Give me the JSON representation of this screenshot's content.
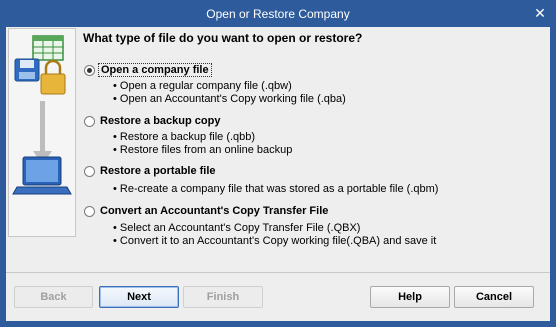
{
  "window": {
    "title": "Open or Restore Company",
    "close_glyph": "✕"
  },
  "question": "What type of file do you want to open or restore?",
  "options": [
    {
      "label": "Open a company file",
      "checked": true,
      "bullets": [
        "Open a regular company file (.qbw)",
        "Open an Accountant's Copy working file (.qba)"
      ]
    },
    {
      "label": "Restore a backup copy",
      "checked": false,
      "bullets": [
        "Restore a backup file (.qbb)",
        "Restore files from an online backup"
      ]
    },
    {
      "label": "Restore a portable file",
      "checked": false,
      "bullets": [
        "Re-create a company file that was stored as a portable file (.qbm)"
      ]
    },
    {
      "label": "Convert an Accountant's Copy Transfer File",
      "checked": false,
      "bullets": [
        "Select an Accountant's Copy Transfer File (.QBX)",
        "Convert it to an Accountant's Copy working file(.QBA) and save it"
      ]
    }
  ],
  "buttons": {
    "back": "Back",
    "next": "Next",
    "finish": "Finish",
    "help": "Help",
    "cancel": "Cancel"
  },
  "colors": {
    "titlebar": "#2e5b9b",
    "dialog_bg": "#eeeeee",
    "accent": "#3a6fb5"
  },
  "icons": [
    "spreadsheet-icon",
    "disk-icon",
    "lock-icon",
    "down-arrow-icon",
    "laptop-icon",
    "close-icon"
  ]
}
